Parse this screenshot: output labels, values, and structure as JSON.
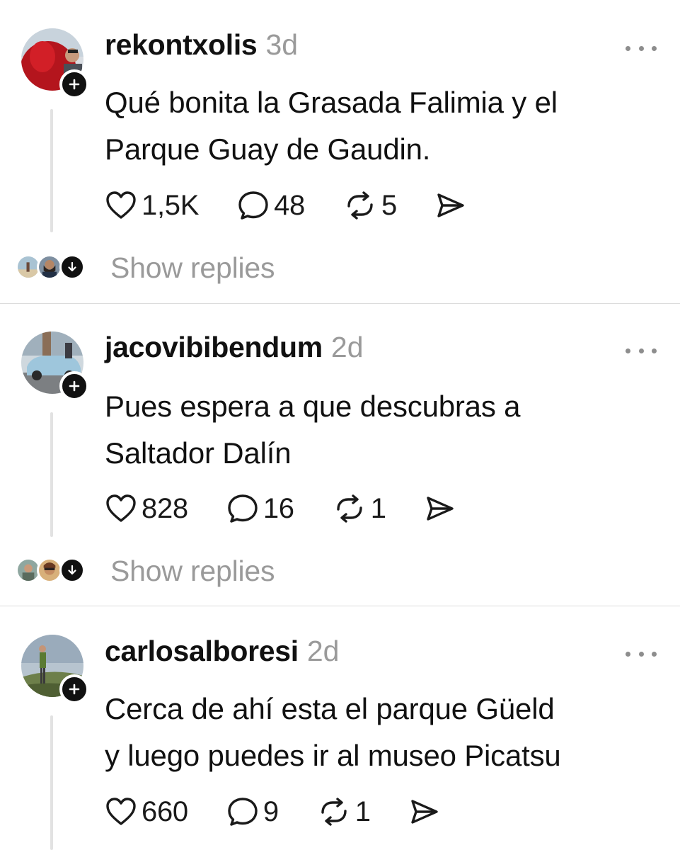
{
  "posts": [
    {
      "username": "rekontxolis",
      "time": "3d",
      "text_lines": [
        "Qué bonita la Grasada Falimia y el",
        "Parque Guay de Gaudin."
      ],
      "likes": "1,5K",
      "replies": "48",
      "reposts": "5",
      "show_replies_label": "Show replies",
      "avatar_colors": [
        "#b4151d",
        "#6d8aa6"
      ]
    },
    {
      "username": "jacovibibendum",
      "time": "2d",
      "text_lines": [
        "Pues espera a que descubras a",
        "Saltador Dalín"
      ],
      "likes": "828",
      "replies": "16",
      "reposts": "1",
      "show_replies_label": "Show replies",
      "avatar_colors": [
        "#8fb1c8",
        "#6a5a4a"
      ]
    },
    {
      "username": "carlosalboresi",
      "time": "2d",
      "text_lines": [
        "Cerca de ahí esta el parque Güeld",
        "y luego puedes ir al museo Picatsu"
      ],
      "likes": "660",
      "replies": "9",
      "reposts": "1",
      "avatar_colors": [
        "#9fb0c0",
        "#4e6a3a"
      ]
    }
  ],
  "icons": {
    "like": "heart-icon",
    "reply": "speech-bubble-icon",
    "repost": "repost-arrows-icon",
    "share": "paper-plane-icon",
    "more": "ellipsis-icon",
    "follow": "plus-icon",
    "expand": "arrow-down-icon"
  }
}
